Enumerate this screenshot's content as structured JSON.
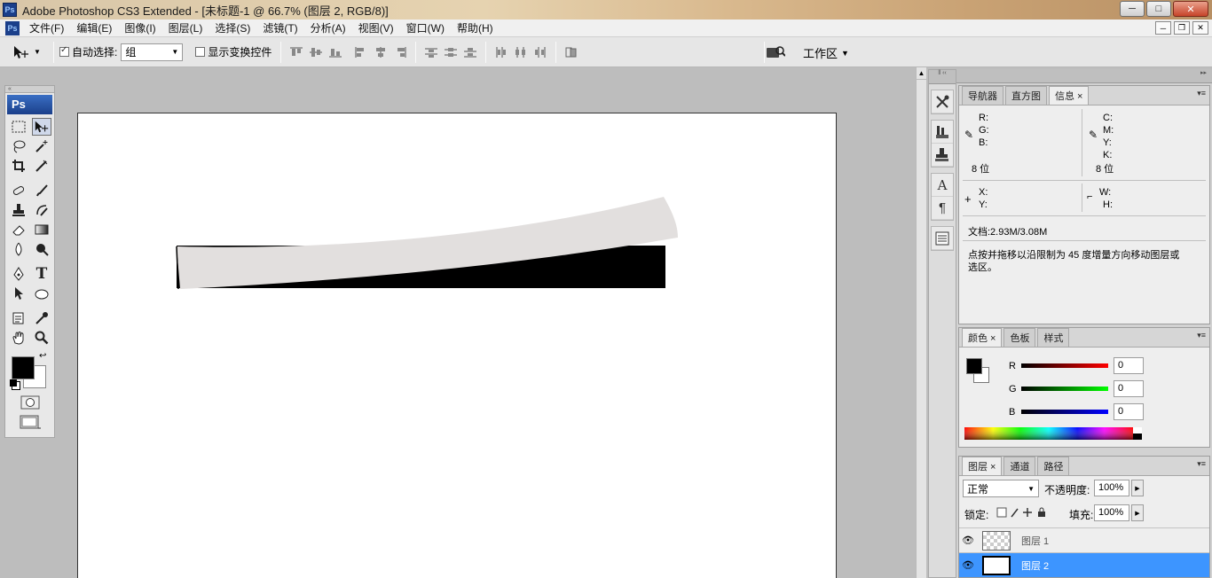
{
  "window": {
    "title": "Adobe Photoshop CS3 Extended - [未标题-1 @ 66.7% (图层 2, RGB/8)]",
    "app_badge": "Ps",
    "minimize": "─",
    "maximize": "□",
    "close": "✕"
  },
  "menu": {
    "items": [
      "文件(F)",
      "编辑(E)",
      "图像(I)",
      "图层(L)",
      "选择(S)",
      "滤镜(T)",
      "分析(A)",
      "视图(V)",
      "窗口(W)",
      "帮助(H)"
    ],
    "doc_minimize": "─",
    "doc_restore": "❐",
    "doc_close": "✕"
  },
  "options": {
    "auto_select_label": "自动选择:",
    "auto_select_checked": true,
    "auto_select_value": "组",
    "show_transform_label": "显示变换控件",
    "show_transform_checked": false,
    "workspace_label": "工作区"
  },
  "toolbox": {
    "badge": "Ps",
    "foreground_color": "#000000",
    "background_color": "#ffffff"
  },
  "info_panel": {
    "tabs": [
      "导航器",
      "直方图",
      "信息"
    ],
    "active_tab": "信息",
    "r_label": "R:",
    "g_label": "G:",
    "b_label": "B:",
    "c_label": "C:",
    "m_label": "M:",
    "y_label": "Y:",
    "k_label": "K:",
    "bits_left": "8 位",
    "bits_right": "8 位",
    "x_label": "X:",
    "y_coord_label": "Y:",
    "w_label": "W:",
    "h_label": "H:",
    "doc_size": "文档:2.93M/3.08M",
    "hint_line1": "点按并拖移以沿限制为 45 度增量方向移动图层或",
    "hint_line2": "选区。"
  },
  "color_panel": {
    "tabs": [
      "颜色",
      "色板",
      "样式"
    ],
    "active_tab": "颜色",
    "r_label": "R",
    "g_label": "G",
    "b_label": "B",
    "r_value": "0",
    "g_value": "0",
    "b_value": "0"
  },
  "layers_panel": {
    "tabs": [
      "图层",
      "通道",
      "路径"
    ],
    "active_tab": "图层",
    "blend_mode": "正常",
    "opacity_label": "不透明度:",
    "opacity_value": "100%",
    "lock_label": "锁定:",
    "fill_label": "填充:",
    "fill_value": "100%",
    "layers": [
      {
        "name": "图层 1",
        "selected": false
      },
      {
        "name": "图层 2",
        "selected": true
      }
    ]
  }
}
